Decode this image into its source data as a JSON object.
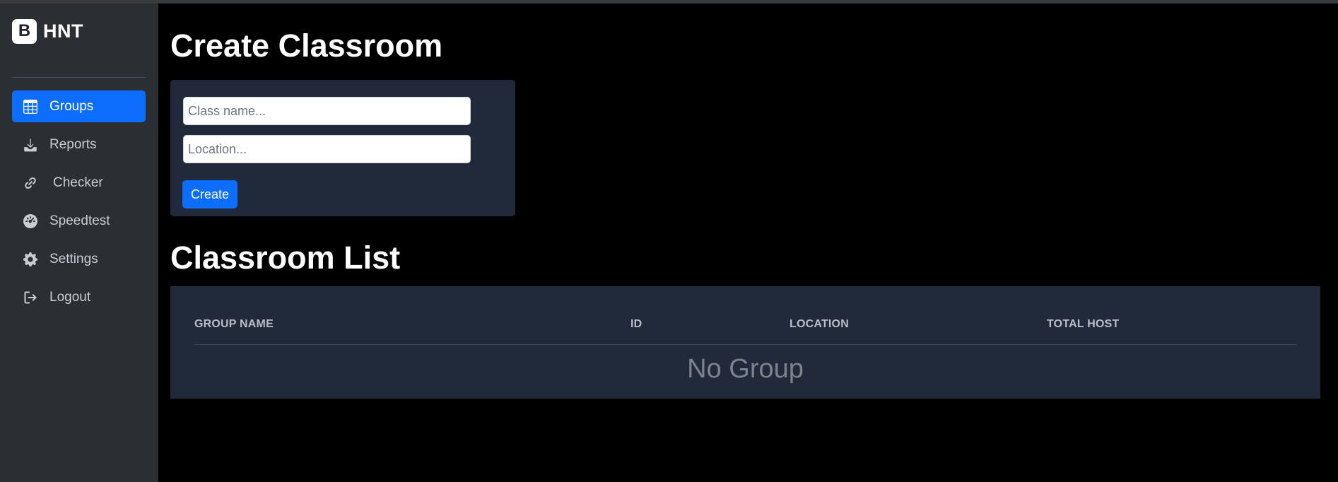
{
  "brand": {
    "logo_letter": "B",
    "name": "HNT"
  },
  "sidebar": {
    "items": [
      {
        "label": "Groups",
        "icon": "table-icon",
        "active": true
      },
      {
        "label": "Reports",
        "icon": "download-icon",
        "active": false
      },
      {
        "label": "Checker",
        "icon": "link-icon",
        "active": false
      },
      {
        "label": "Speedtest",
        "icon": "speedometer-icon",
        "active": false
      },
      {
        "label": "Settings",
        "icon": "gear-icon",
        "active": false
      },
      {
        "label": "Logout",
        "icon": "logout-icon",
        "active": false
      }
    ]
  },
  "create_form": {
    "title": "Create Classroom",
    "class_name_placeholder": "Class name...",
    "class_name_value": "",
    "location_placeholder": "Location...",
    "location_value": "",
    "submit_label": "Create"
  },
  "classroom_list": {
    "title": "Classroom List",
    "columns": [
      "GROUP NAME",
      "ID",
      "LOCATION",
      "TOTAL HOST"
    ],
    "rows": [],
    "empty_message": "No Group"
  },
  "colors": {
    "accent": "#0d6efd",
    "sidebar_bg": "#2b2e33",
    "card_bg": "#212a3a",
    "page_bg": "#000000"
  }
}
